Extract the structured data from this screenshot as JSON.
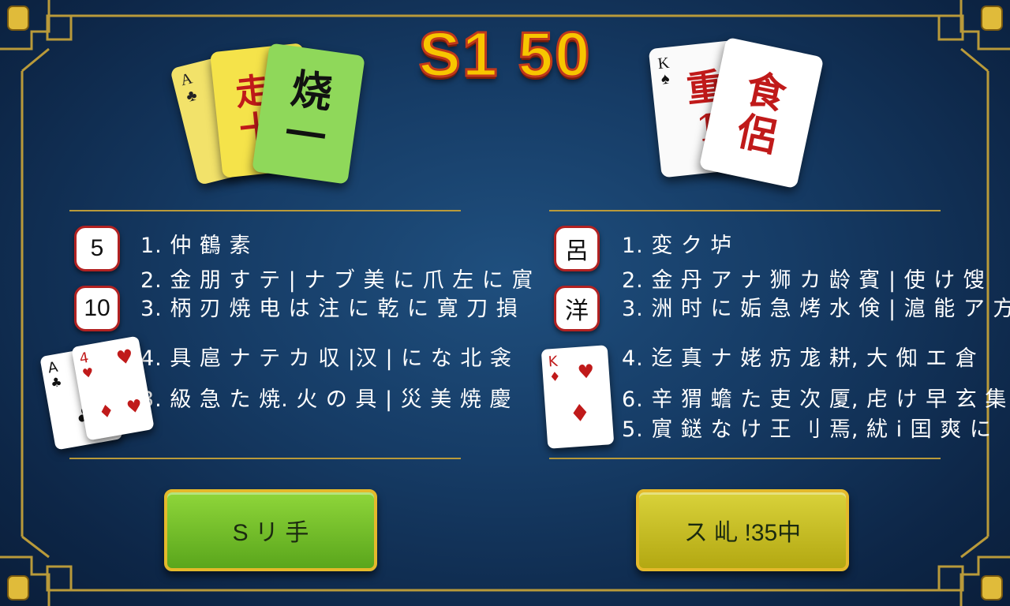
{
  "title": "S1 50",
  "colors": {
    "gold": "#b99a3a",
    "title_fill": "#f7c600",
    "title_stroke": "#c0391b",
    "green_btn": "#7cc42d",
    "yellow_btn": "#c9c022",
    "bg": "#163c66"
  },
  "left_panel": {
    "cards": [
      {
        "corner_rank": "A",
        "corner_suit": "♣",
        "text": "走"
      },
      {
        "text": "走\n十"
      },
      {
        "text": "烧\n一"
      }
    ],
    "badges": [
      "5",
      "10"
    ],
    "rules": [
      "1. 仲 鶴 素",
      "2. 金 朋 す テ | ナ ブ 美 に 爪 左 に 賔",
      "3. 柄 刃 焼 电 は 注 に 乾 に 寛 刀 損",
      "4. 具 扈 ナ テ カ 収 |汉 | に な 北 衾",
      "3. 級 急 た 焼. 火 の 具 | 災 美 焼 慶"
    ],
    "bottom_cards": [
      {
        "rank": "A",
        "suit": "♣"
      },
      {
        "rank": "4",
        "suit": "♥"
      }
    ],
    "button_label": "S リ 手"
  },
  "right_panel": {
    "cards": [
      {
        "corner_rank": "K",
        "corner_suit": "♠",
        "text": "重\n1"
      },
      {
        "text": "食\n侶"
      }
    ],
    "badges": [
      "呂",
      "洋"
    ],
    "rules": [
      "1. 変 ク 垆",
      "2. 金 丹 ア ナ 狮 カ 龄 賓 | 使 け 馊",
      "3. 洲 时 に 姤 急 烤 水 倹 | 滬 能 ア 方",
      "4. 迄 真 ナ 姥 疓 尨 耕, 大 倁 エ 倉",
      "6. 辛 猬 蟾 た 吏 次 厦, 虍 け 早 玄 集",
      "5. 賔 鎹 な け 王 刂 焉, 紌 i 囯 爽 に"
    ],
    "bottom_card": {
      "rank": "K",
      "suit": "♦"
    },
    "button_label": "ス 乢 !35中"
  }
}
